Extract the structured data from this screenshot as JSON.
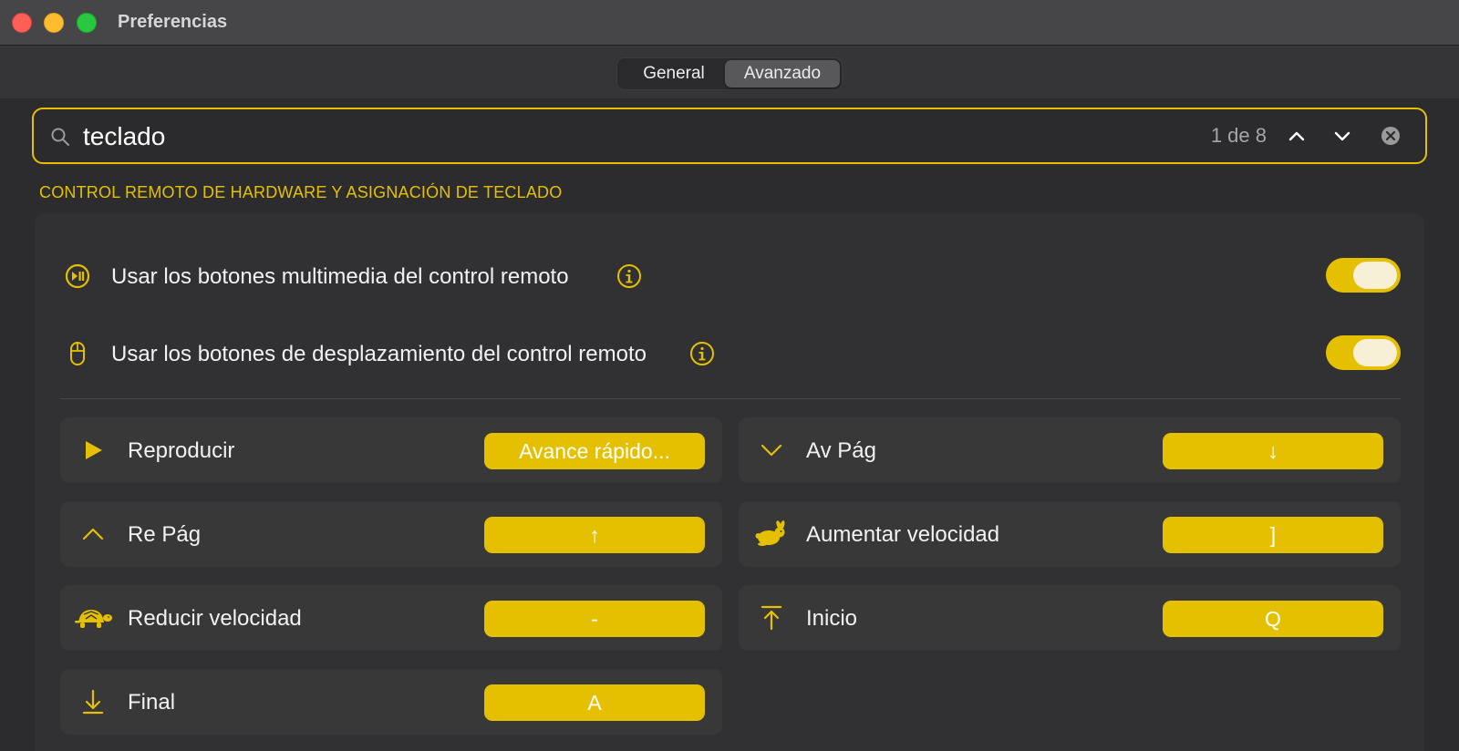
{
  "window": {
    "title": "Preferencias"
  },
  "tabs": [
    {
      "label": "General",
      "selected": false
    },
    {
      "label": "Avanzado",
      "selected": true
    }
  ],
  "search": {
    "value": "teclado",
    "match_count": "1 de 8",
    "icons": {
      "search": "magnifier-icon",
      "prev": "chevron-up-icon",
      "next": "chevron-down-icon",
      "clear": "clear-circle-icon"
    }
  },
  "section": {
    "title": "CONTROL REMOTO DE HARDWARE Y ASIGNACIÓN DE TECLADO",
    "toggles": [
      {
        "label": "Usar los botones multimedia del control remoto",
        "icon": "play-pause-circle-icon",
        "on": true
      },
      {
        "label": "Usar los botones de desplazamiento del control remoto",
        "icon": "mouse-icon",
        "on": true
      }
    ],
    "shortcuts": [
      {
        "label": "Reproducir",
        "key": "Avance rápido...",
        "icon": "play-icon"
      },
      {
        "label": "Av Pág",
        "key": "↓",
        "icon": "chevron-down-icon"
      },
      {
        "label": "Re Pág",
        "key": "↑",
        "icon": "chevron-up-icon"
      },
      {
        "label": "Aumentar velocidad",
        "key": "]",
        "icon": "rabbit-icon"
      },
      {
        "label": "Reducir velocidad",
        "key": "-",
        "icon": "turtle-icon"
      },
      {
        "label": "Inicio",
        "key": "Q",
        "icon": "arrow-up-to-line-icon"
      },
      {
        "label": "Final",
        "key": "A",
        "icon": "arrow-down-to-line-icon"
      }
    ]
  },
  "colors": {
    "accent": "#e5c000",
    "window_bg": "#2c2c2e",
    "card_bg": "#383839",
    "titlebar_bg": "#464648"
  }
}
